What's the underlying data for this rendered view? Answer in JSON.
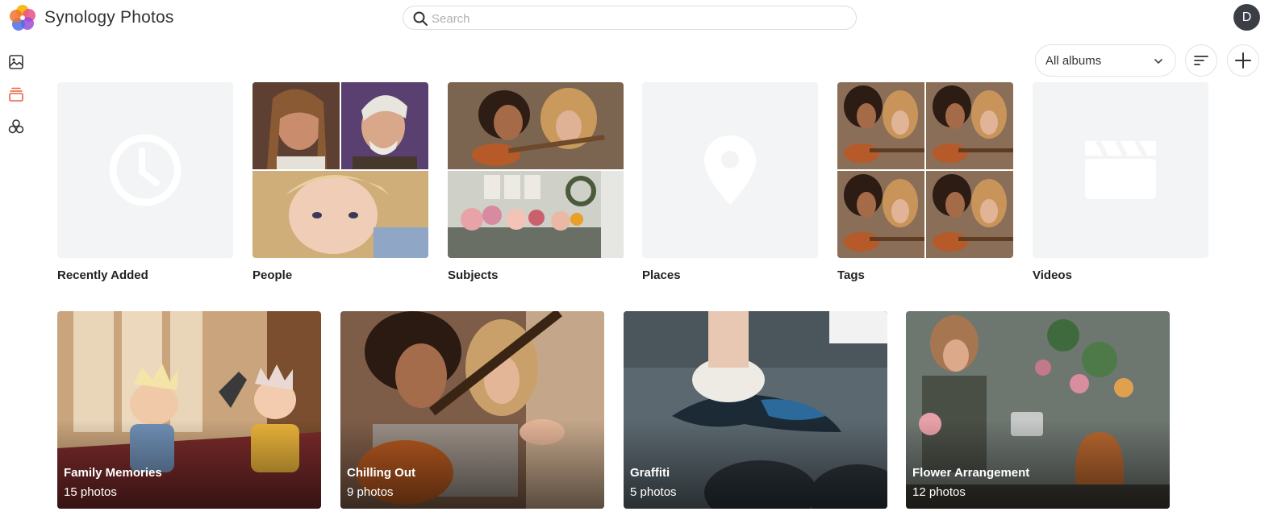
{
  "app": {
    "title": "Synology Photos",
    "avatar_letter": "D"
  },
  "search": {
    "placeholder": "Search",
    "value": ""
  },
  "sidebar": {
    "items": [
      {
        "icon": "image-icon",
        "active": false
      },
      {
        "icon": "albums-icon",
        "active": true
      },
      {
        "icon": "shared-icon",
        "active": false
      }
    ]
  },
  "toolbar": {
    "album_filter": "All albums",
    "sort_icon": "sort-icon",
    "add_icon": "plus-icon"
  },
  "categories": [
    {
      "label": "Recently Added",
      "icon": "clock-icon"
    },
    {
      "label": "People",
      "icon": "people-photos"
    },
    {
      "label": "Subjects",
      "icon": "subjects-photos"
    },
    {
      "label": "Places",
      "icon": "map-pin-icon"
    },
    {
      "label": "Tags",
      "icon": "tags-photos"
    },
    {
      "label": "Videos",
      "icon": "clapperboard-icon"
    }
  ],
  "albums": [
    {
      "title": "Family Memories",
      "count": "15 photos"
    },
    {
      "title": "Chilling Out",
      "count": "9 photos"
    },
    {
      "title": "Graffiti",
      "count": "5 photos"
    },
    {
      "title": "Flower Arrangement",
      "count": "12 photos"
    }
  ],
  "colors": {
    "accent": "#e8603c",
    "placeholder_bg": "#f3f4f5",
    "placeholder_icon": "#ffffff"
  }
}
